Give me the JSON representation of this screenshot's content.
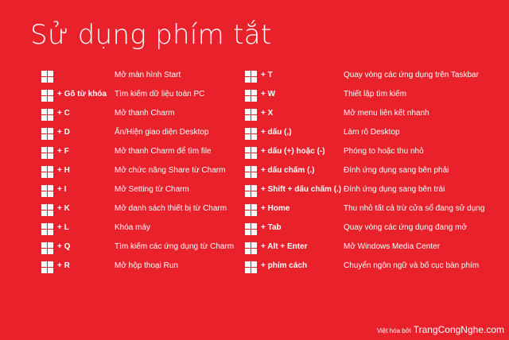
{
  "title": "Sử dụng phím tắt",
  "left_shortcuts": [
    {
      "key": "",
      "desc": "Mở màn hình  Start"
    },
    {
      "key": "+  Gõ từ khóa",
      "desc": "Tìm kiếm dữ liệu toàn PC"
    },
    {
      "key": "+  C",
      "desc": "Mở thanh Charm"
    },
    {
      "key": "+  D",
      "desc": "Ẩn/Hiện giao diện Desktop"
    },
    {
      "key": "+  F",
      "desc": "Mở thanh Charm để tìm file"
    },
    {
      "key": "+  H",
      "desc": "Mở chức năng Share từ Charm"
    },
    {
      "key": "+  I",
      "desc": "Mở Setting từ Charm"
    },
    {
      "key": "+  K",
      "desc": "Mở danh sách thiết bị từ Charm"
    },
    {
      "key": "+  L",
      "desc": "Khóa máy"
    },
    {
      "key": "+  Q",
      "desc": "Tìm kiếm các ứng dụng từ Charm"
    },
    {
      "key": "+  R",
      "desc": "Mở hộp thoại Run"
    }
  ],
  "right_shortcuts": [
    {
      "key": "+  T",
      "desc": "Quay vòng các ứng dụng trên Taskbar"
    },
    {
      "key": "+  W",
      "desc": "Thiết lập tìm kiếm"
    },
    {
      "key": "+  X",
      "desc": "Mở menu liên kết nhanh"
    },
    {
      "key": "+  dấu (,)",
      "desc": "Làm rõ Desktop"
    },
    {
      "key": "+  dấu (+) hoặc (-)",
      "desc": "Phóng to hoặc thu nhỏ"
    },
    {
      "key": "+  dấu chấm (.)",
      "desc": "Đính ứng dụng sang bên phải"
    },
    {
      "key": "+  Shift + dấu chấm (.)",
      "desc": "Đính ứng dụng sang bên trái"
    },
    {
      "key": "+  Home",
      "desc": "Thu nhỏ tất cả trừ cửa sổ đang sử dụng"
    },
    {
      "key": "+  Tab",
      "desc": "Quay vòng các ứng dụng đang mở"
    },
    {
      "key": "+  Alt + Enter",
      "desc": "Mở Windows Media Center"
    },
    {
      "key": "+  phím cách",
      "desc": "Chuyển ngôn ngữ và bố cục bàn phím"
    }
  ],
  "credit": {
    "prefix": "Việt hóa bởi",
    "site": "TrangCongNghe.com"
  },
  "icon": "windows-logo-icon",
  "colors": {
    "background": "#e8212b",
    "text": "#ffffff"
  }
}
